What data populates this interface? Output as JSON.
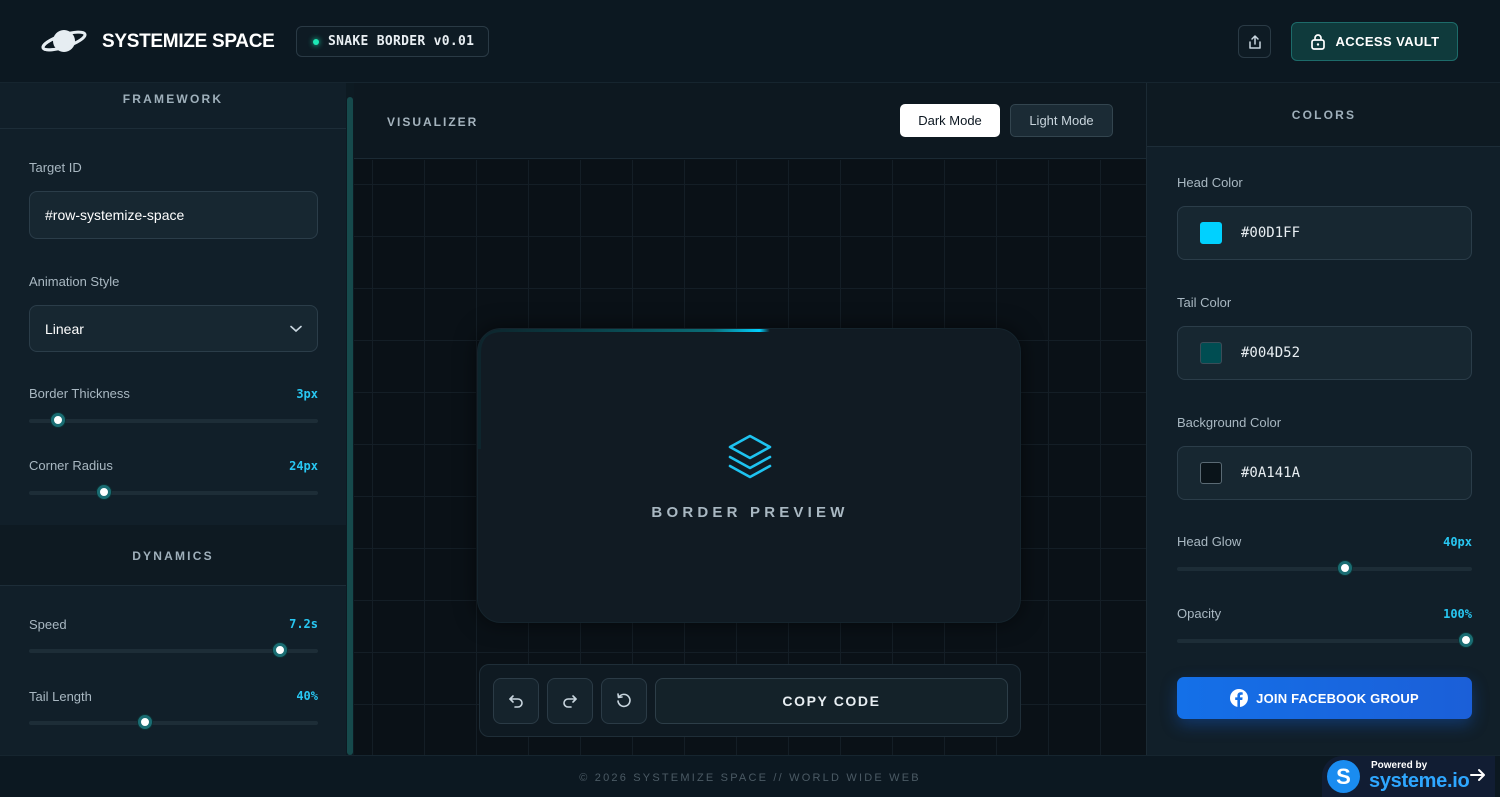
{
  "header": {
    "brand": "SYSTEMIZE SPACE",
    "version_badge": "SNAKE BORDER v0.01",
    "vault_label": "ACCESS VAULT"
  },
  "left": {
    "framework_title": "FRAMEWORK",
    "target_id_label": "Target ID",
    "target_id_value": "#row-systemize-space",
    "animation_style_label": "Animation Style",
    "animation_style_value": "Linear",
    "border_thickness_label": "Border Thickness",
    "border_thickness_value": "3px",
    "corner_radius_label": "Corner Radius",
    "corner_radius_value": "24px",
    "dynamics_title": "DYNAMICS",
    "speed_label": "Speed",
    "speed_value": "7.2s",
    "tail_length_label": "Tail Length",
    "tail_length_value": "40%"
  },
  "sliders": {
    "border_thickness_fraction": 0.1,
    "corner_radius_fraction": 0.26,
    "speed_fraction": 0.87,
    "tail_length_fraction": 0.4,
    "head_glow_fraction": 0.57,
    "opacity_fraction": 0.98
  },
  "center": {
    "visualizer_label": "VISUALIZER",
    "dark_mode_label": "Dark Mode",
    "light_mode_label": "Light Mode",
    "preview_label": "BORDER PREVIEW",
    "copy_label": "COPY CODE"
  },
  "right": {
    "colors_title": "COLORS",
    "head_color_label": "Head Color",
    "head_color_value": "#00D1FF",
    "tail_color_label": "Tail Color",
    "tail_color_value": "#004D52",
    "background_color_label": "Background Color",
    "background_color_value": "#0A141A",
    "head_glow_label": "Head Glow",
    "head_glow_value": "40px",
    "opacity_label": "Opacity",
    "opacity_value": "100%",
    "facebook_label": "JOIN FACEBOOK GROUP"
  },
  "footer": {
    "copyright": "© 2026 SYSTEMIZE SPACE // WORLD WIDE WEB",
    "powered_by": "Powered by",
    "powered_name": "systeme.io"
  },
  "icons": {
    "logo": "planet-icon",
    "share": "share-icon",
    "vault": "lock-icon",
    "preview": "layers-icon",
    "undo": "undo-icon",
    "redo": "redo-icon",
    "reset": "reset-icon",
    "facebook": "facebook-icon",
    "powered_arrow": "arrow-right-icon"
  }
}
